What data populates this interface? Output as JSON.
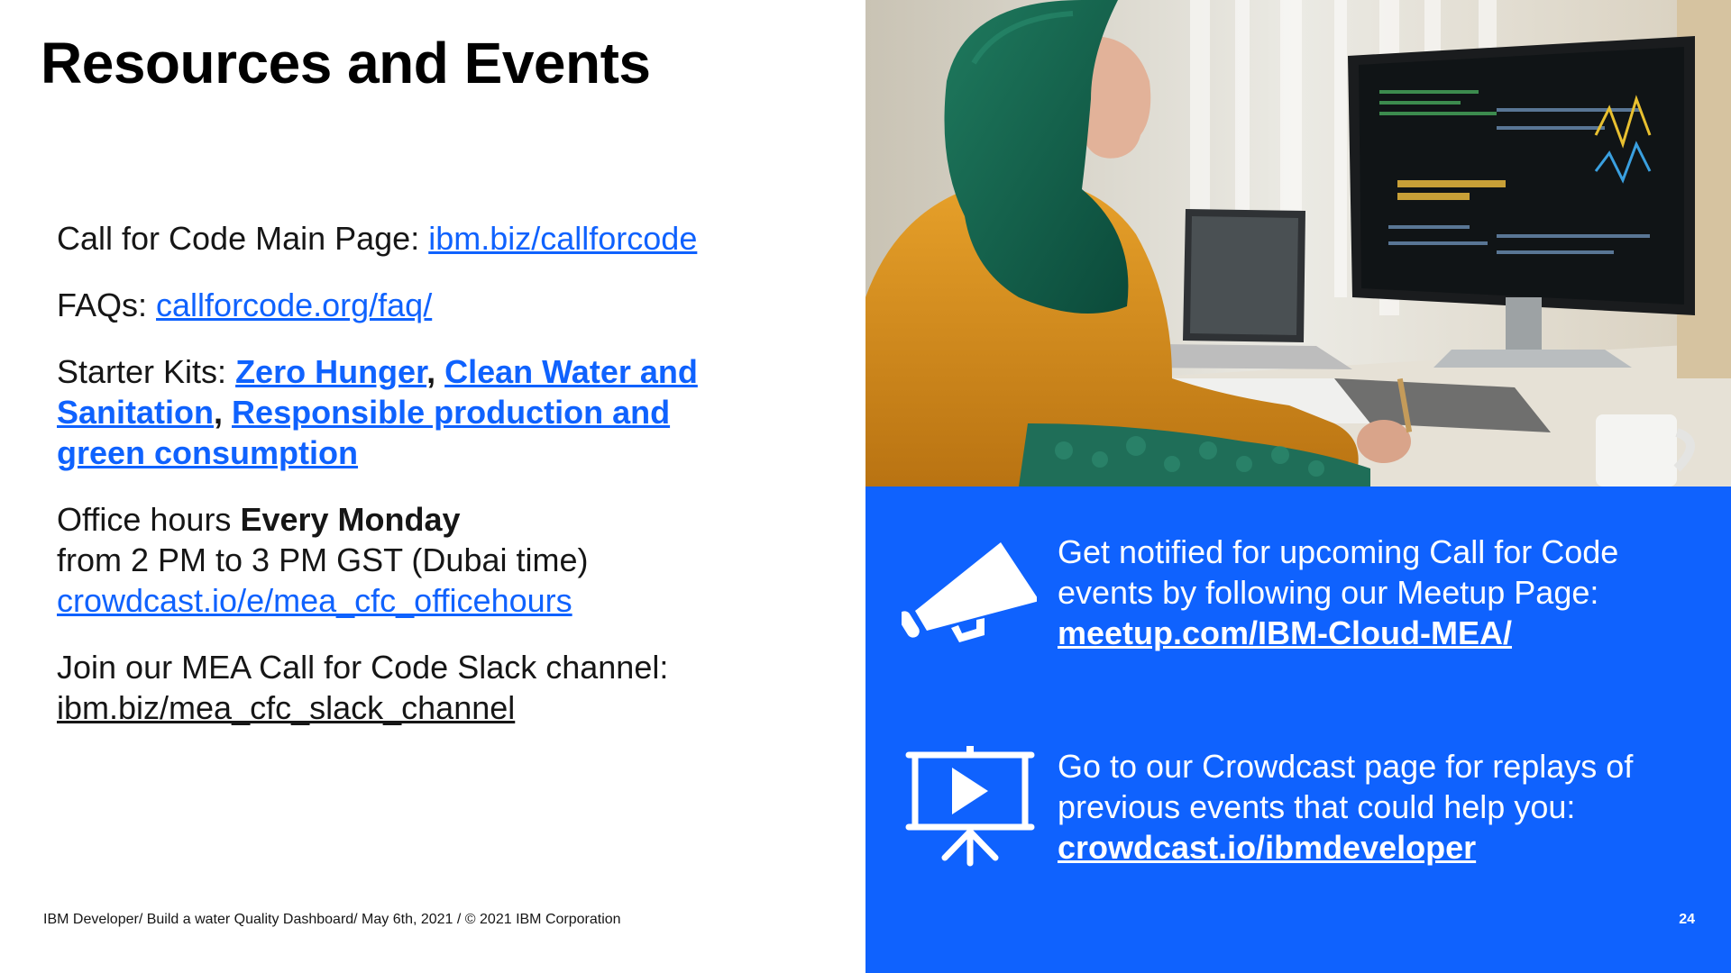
{
  "slide": {
    "title": "Resources and Events",
    "footer": "IBM Developer/ Build a water Quality Dashboard/ May 6th, 2021 / © 2021 IBM Corporation",
    "page_number": "24"
  },
  "resources": {
    "main_page_label": "Call for Code Main Page: ",
    "main_page_link": "ibm.biz/callforcode",
    "faqs_label": "FAQs: ",
    "faqs_link": "callforcode.org/faq/",
    "starter_kits_label": "Starter Kits: ",
    "kit_1": "Zero Hunger",
    "kit_2": "Clean Water and Sanitation",
    "kit_3": "Responsible production and green consumption",
    "separator": ",",
    "office_hours_label": "Office hours ",
    "office_hours_day": "Every Monday",
    "office_hours_time": "from 2 PM to 3 PM GST (Dubai time)",
    "office_hours_link": "crowdcast.io/e/mea_cfc_officehours",
    "slack_label": "Join our MEA Call for Code Slack channel:",
    "slack_link": "ibm.biz/mea_cfc_slack_channel"
  },
  "events": {
    "meetup_text": "Get notified for upcoming Call for Code events by following our Meetup Page:",
    "meetup_link": "meetup.com/IBM-Cloud-MEA/",
    "crowdcast_text": "Go to our Crowdcast page for replays of previous events that could help you:",
    "crowdcast_link": "crowdcast.io/ibmdeveloper"
  },
  "icons": {
    "megaphone": "megaphone-icon",
    "presentation": "presentation-play-icon"
  },
  "colors": {
    "brand_blue": "#0f62fe",
    "text": "#161616"
  }
}
